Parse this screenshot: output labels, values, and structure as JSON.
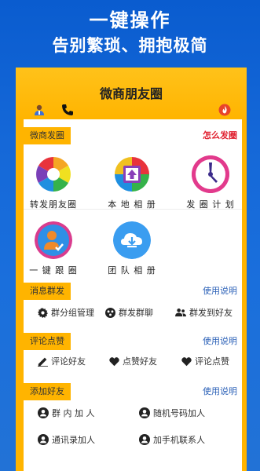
{
  "promo": {
    "line1": "一键操作",
    "line2": "告别繁琐、拥抱极简"
  },
  "app": {
    "title": "微商朋友圈"
  },
  "sections": {
    "moments": {
      "label": "微商发圈",
      "link": "怎么发圈",
      "items": [
        {
          "label": "转发朋友圈"
        },
        {
          "label": "本 地 相 册"
        },
        {
          "label": "发 圈 计 划"
        },
        {
          "label": "一 键 跟 圈"
        },
        {
          "label": "团 队 相 册"
        }
      ]
    },
    "group_msg": {
      "label": "消息群发",
      "link": "使用说明",
      "items": [
        {
          "label": "群分组管理"
        },
        {
          "label": "群发群聊"
        },
        {
          "label": "群发到好友"
        }
      ]
    },
    "comments": {
      "label": "评论点赞",
      "link": "使用说明",
      "items": [
        {
          "label": "评论好友"
        },
        {
          "label": "点赞好友"
        },
        {
          "label": "评论点赞"
        }
      ]
    },
    "add_friends": {
      "label": "添加好友",
      "link": "使用说明",
      "items": [
        {
          "label": "群 内 加 人"
        },
        {
          "label": "随机号码加人"
        },
        {
          "label": "通讯录加人"
        },
        {
          "label": "加手机联系人"
        }
      ]
    }
  },
  "colors": {
    "accent": "#ffb400",
    "link": "#2d62b8",
    "link_red": "#e0202f",
    "background": "#1568d8"
  }
}
